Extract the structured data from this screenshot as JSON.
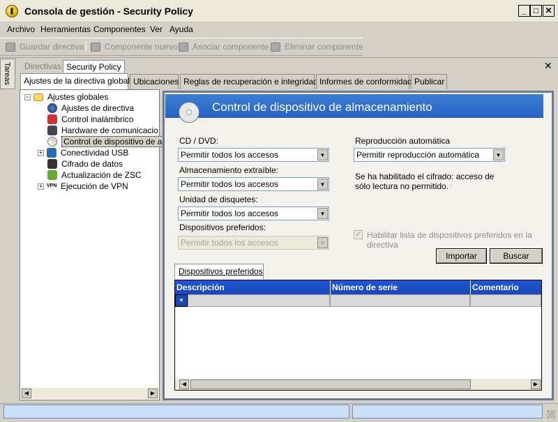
{
  "window": {
    "title": "Consola de gestión - Security Policy",
    "min_glyph": "_",
    "max_glyph": "□",
    "close_glyph": "✕"
  },
  "menu": [
    "Archivo",
    "Herramientas",
    "Componentes",
    "Ver",
    "Ayuda"
  ],
  "toolbar": {
    "save_label": "Guardar directiva",
    "new_component_label": "Componente nuevo",
    "associate_label": "Asociar componente",
    "delete_label": "Eliminar componente"
  },
  "side_tab": "Tareas",
  "doc_tabs": {
    "directivas": "Directivas",
    "security_policy": "Security Policy",
    "close_glyph": "✕"
  },
  "policy_tabs": [
    "Ajustes de la directiva global",
    "Ubicaciones",
    "Reglas de recuperación e integridad",
    "Informes de conformidad",
    "Publicar"
  ],
  "tree": {
    "root": "Ajustes globales",
    "items": [
      "Ajustes de directiva",
      "Control inalámbrico",
      "Hardware de comunicacio",
      "Control de dispositivo de al",
      "Conectividad USB",
      "Cifrado de datos",
      "Actualización de ZSC",
      "Ejecución de VPN"
    ],
    "expand_glyph": "+",
    "collapse_glyph": "−"
  },
  "panel": {
    "title": "Control de dispositivo de almacenamiento",
    "cd_label": "CD / DVD:",
    "cd_value": "Permitir todos los accesos",
    "removable_label": "Almacenamiento extraíble:",
    "removable_value": "Permitir todos los accesos",
    "floppy_label": "Unidad de disquetes:",
    "floppy_value": "Permitir todos los accesos",
    "preferred_label": "Dispositivos preferidos:",
    "preferred_value": "Permitir todos los accesos",
    "autoplay_label": "Reproducción automática",
    "autoplay_value": "Permitir reproducción automática",
    "info_line1": "Se ha habilitado el cifrado: acceso de",
    "info_line2": "sólo lectura no permitido.",
    "checkbox_label": "Habilitar lista de dispositivos preferidos en la directiva",
    "checkbox_glyph": "✓",
    "import_label": "Importar",
    "search_label": "Buscar",
    "preferred_tab": "Dispositivos preferidos",
    "dropdown_glyph": "▼"
  },
  "grid": {
    "columns": [
      "Descripción",
      "Número de serie",
      "Comentario"
    ],
    "new_row_marker": "*"
  },
  "scroll": {
    "left": "◀",
    "right": "▶",
    "up": "▲",
    "down": "▼"
  }
}
